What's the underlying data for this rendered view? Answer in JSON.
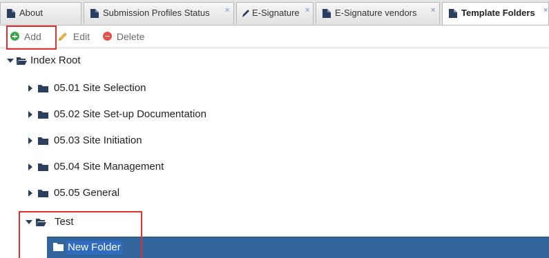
{
  "tabs": [
    {
      "label": "About",
      "icon": "document-icon",
      "closable": false,
      "active": false
    },
    {
      "label": "Submission Profiles Status",
      "icon": "document-icon",
      "closable": true,
      "active": false
    },
    {
      "label": "E-Signature",
      "icon": "pen-icon",
      "closable": true,
      "active": false
    },
    {
      "label": "E-Signature vendors",
      "icon": "document-icon",
      "closable": true,
      "active": false
    },
    {
      "label": "Template Folders",
      "icon": "document-icon",
      "closable": true,
      "active": true
    }
  ],
  "close_glyph": "×",
  "toolbar": {
    "add_label": "Add",
    "edit_label": "Edit",
    "delete_label": "Delete"
  },
  "tree": {
    "root_label": "Index Root",
    "items": [
      {
        "label": "05.01 Site Selection",
        "expanded": false
      },
      {
        "label": "05.02 Site Set-up Documentation",
        "expanded": false
      },
      {
        "label": "05.03 Site Initiation",
        "expanded": false
      },
      {
        "label": "05.04 Site Management",
        "expanded": false
      },
      {
        "label": "05.05 General",
        "expanded": false
      },
      {
        "label": "Test",
        "expanded": true
      }
    ],
    "new_folder_value": "New Folder"
  },
  "colors": {
    "folder": "#2a3f5f",
    "highlight": "#e03030",
    "selection_bar": "#33649b",
    "add": "#3aa74a",
    "delete": "#e5514a",
    "edit": "#e6b04a"
  }
}
